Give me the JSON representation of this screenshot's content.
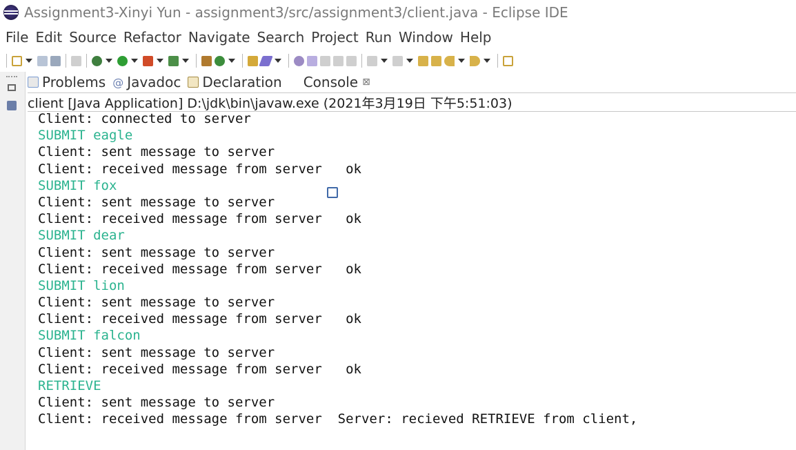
{
  "window": {
    "title": "Assignment3-Xinyi Yun - assignment3/src/assignment3/client.java - Eclipse IDE"
  },
  "menu": [
    "File",
    "Edit",
    "Source",
    "Refactor",
    "Navigate",
    "Search",
    "Project",
    "Run",
    "Window",
    "Help"
  ],
  "tabs": [
    {
      "label": "Problems",
      "icon": "problems-icon"
    },
    {
      "label": "Javadoc",
      "icon": "javadoc-icon",
      "glyph": "@"
    },
    {
      "label": "Declaration",
      "icon": "declaration-icon"
    },
    {
      "label": "Console",
      "icon": "console-icon",
      "close": "⊠"
    }
  ],
  "console": {
    "launch": "client [Java Application] D:\\jdk\\bin\\javaw.exe  (2021年3月19日 下午5:51:03)",
    "lines": [
      {
        "text": "Client: connected to server",
        "kind": "out"
      },
      {
        "text": "SUBMIT eagle",
        "kind": "in"
      },
      {
        "text": "Client: sent message to server",
        "kind": "out"
      },
      {
        "text": "Client: received message from server   ok",
        "kind": "out"
      },
      {
        "text": "SUBMIT fox",
        "kind": "in"
      },
      {
        "text": "Client: sent message to server",
        "kind": "out"
      },
      {
        "text": "Client: received message from server   ok",
        "kind": "out"
      },
      {
        "text": "SUBMIT dear",
        "kind": "in"
      },
      {
        "text": "Client: sent message to server",
        "kind": "out"
      },
      {
        "text": "Client: received message from server   ok",
        "kind": "out"
      },
      {
        "text": "SUBMIT lion",
        "kind": "in"
      },
      {
        "text": "Client: sent message to server",
        "kind": "out"
      },
      {
        "text": "Client: received message from server   ok",
        "kind": "out"
      },
      {
        "text": "SUBMIT falcon",
        "kind": "in"
      },
      {
        "text": "Client: sent message to server",
        "kind": "out"
      },
      {
        "text": "Client: received message from server   ok",
        "kind": "out"
      },
      {
        "text": "RETRIEVE",
        "kind": "in"
      },
      {
        "text": "Client: sent message to server",
        "kind": "out"
      },
      {
        "text": "Client: received message from server  Server: recieved RETRIEVE from client,",
        "kind": "out"
      }
    ]
  },
  "colors": {
    "input_text": "#2bb38f",
    "output_text": "#111111",
    "title_text": "#7a7a7a"
  }
}
